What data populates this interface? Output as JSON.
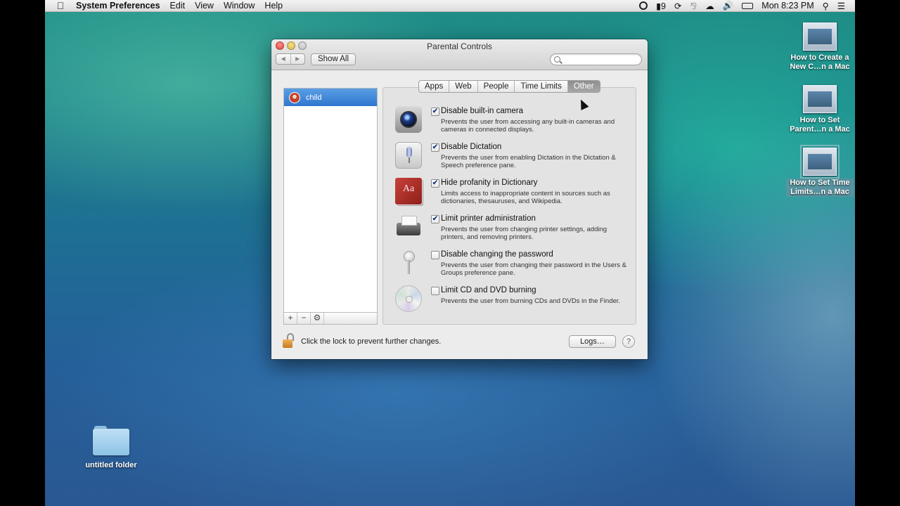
{
  "menubar": {
    "app_name": "System Preferences",
    "menus": [
      "Edit",
      "View",
      "Window",
      "Help"
    ],
    "status": {
      "battery_num": "9",
      "clock": "Mon 8:23 PM"
    }
  },
  "desktop": {
    "icons": [
      {
        "label": "How to Create a New C…n a Mac"
      },
      {
        "label": "How to Set Parent…n a Mac"
      },
      {
        "label": "How to Set Time Limits…n a Mac"
      },
      {
        "label": "untitled folder"
      }
    ]
  },
  "window": {
    "title": "Parental Controls",
    "show_all": "Show All",
    "search_placeholder": "",
    "users": [
      {
        "name": "child"
      }
    ],
    "list_buttons": [
      "+",
      "−",
      "⚙"
    ],
    "tabs": [
      "Apps",
      "Web",
      "People",
      "Time Limits",
      "Other"
    ],
    "active_tab": "Other",
    "options": [
      {
        "icon": "camera-icon",
        "checked": true,
        "title": "Disable built-in camera",
        "desc": "Prevents the user from accessing any built-in cameras and cameras in connected displays."
      },
      {
        "icon": "microphone-icon",
        "checked": true,
        "title": "Disable Dictation",
        "desc": "Prevents the user from enabling Dictation in the Dictation & Speech preference pane."
      },
      {
        "icon": "dictionary-icon",
        "checked": true,
        "title": "Hide profanity in Dictionary",
        "desc": "Limits access to inappropriate content in sources such as dictionaries, thesauruses, and Wikipedia."
      },
      {
        "icon": "printer-icon",
        "checked": true,
        "title": "Limit printer administration",
        "desc": "Prevents the user from changing printer settings, adding printers, and removing printers."
      },
      {
        "icon": "key-icon",
        "checked": false,
        "title": "Disable changing the password",
        "desc": "Prevents the user from changing their password in the Users & Groups preference pane."
      },
      {
        "icon": "cd-icon",
        "checked": false,
        "title": "Limit CD and DVD burning",
        "desc": "Prevents the user from burning CDs and DVDs in the Finder."
      }
    ],
    "dict_icon_text": "Aa",
    "lock_message": "Click the lock to prevent further changes.",
    "logs_button": "Logs…",
    "help_button": "?"
  }
}
